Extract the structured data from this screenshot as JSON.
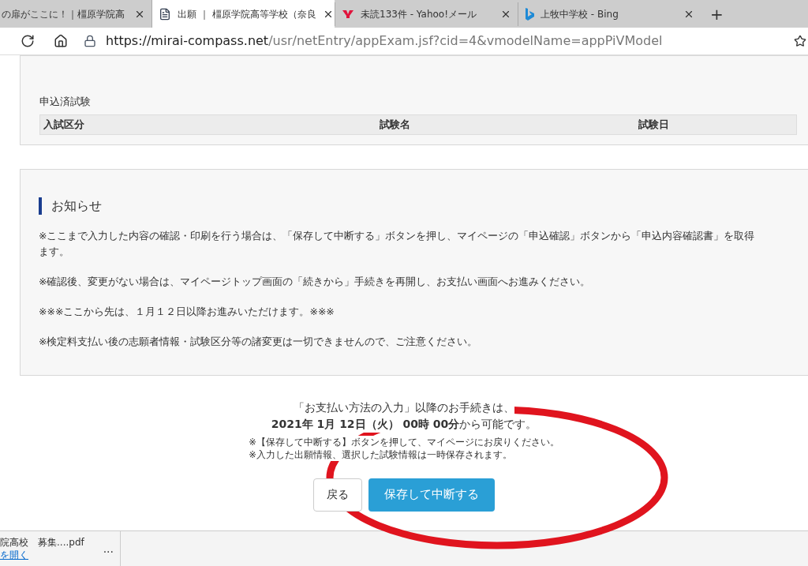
{
  "browser": {
    "tabs": [
      {
        "title": "の扉がここに！｜橿原学院高",
        "selected": false
      },
      {
        "title": "出願 ｜ 橿原学院高等学校（奈良",
        "selected": true,
        "kind": "page"
      },
      {
        "title": "未読133件 - Yahoo!メール",
        "selected": false,
        "kind": "yahoo"
      },
      {
        "title": "上牧中学校 - Bing",
        "selected": false,
        "kind": "bing"
      }
    ],
    "new_tab": "+",
    "url": {
      "domain": "https://mirai-compass.net",
      "path": "/usr/netEntry/appExam.jsf?cid=4&vmodelName=appPiVModel"
    }
  },
  "applied_exams": {
    "title": "申込済試験",
    "columns": [
      "入試区分",
      "試験名",
      "試験日"
    ]
  },
  "notice": {
    "title": "お知らせ",
    "paragraphs": [
      [
        "※ここまで入力した内容の確認・印刷を行う場合は、「保存して中断する」ボタンを押し、マイページの「申込確認」ボタンから「申込内容確認書」を取得",
        "ます。"
      ],
      [
        "※確認後、変更がない場合は、マイページトップ画面の「続きから」手続きを再開し、お支払い画面へお進みください。"
      ],
      [
        "※※※ここから先は、１月１２日以降お進みいただけます。※※※"
      ],
      [
        "※検定料支払い後の志願者情報・試験区分等の諸変更は一切できませんので、ご注意ください。"
      ]
    ]
  },
  "payment_info": {
    "line1": "「お支払い方法の入力」以降のお手続きは、",
    "line2": "**2021年 1月 12日（火） 00時 00分**から可能です。",
    "notes": [
      "※【保存して中断する】ボタンを押して、マイページにお戻りください。",
      "※入力した出願情報、選択した試験情報は一時保存されます。"
    ]
  },
  "buttons": {
    "back": "戻る",
    "save": "保存して中断する"
  },
  "download": {
    "file": "院高校　募集....pdf",
    "link": "を開く",
    "more": "..."
  }
}
